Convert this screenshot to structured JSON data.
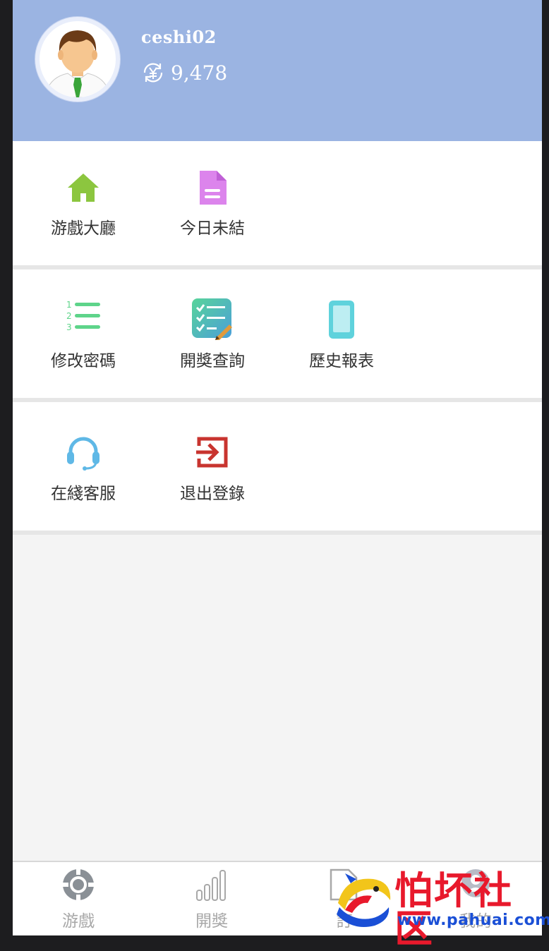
{
  "profile": {
    "username": "ceshi02",
    "balance": "9,478",
    "balance_icon": "yen-exchange-icon",
    "avatar_icon": "male-user-avatar"
  },
  "menu": {
    "row1": [
      {
        "label": "游戲大廳",
        "icon": "home-icon",
        "color": "#8cc63f"
      },
      {
        "label": "今日未結",
        "icon": "document-icon",
        "color": "#d97de8"
      }
    ],
    "row2": [
      {
        "label": "修改密碼",
        "icon": "numbered-list-icon",
        "color": "#5ed48a"
      },
      {
        "label": "開獎查詢",
        "icon": "checklist-icon",
        "color": "#4fb6d6"
      },
      {
        "label": "歷史報表",
        "icon": "tablet-icon",
        "color": "#5fd2dc"
      }
    ],
    "row3": [
      {
        "label": "在綫客服",
        "icon": "headset-icon",
        "color": "#5fb8e6"
      },
      {
        "label": "退出登錄",
        "icon": "logout-icon",
        "color": "#c8342f"
      }
    ]
  },
  "tabbar": {
    "tabs": [
      {
        "label": "游戲",
        "icon": "game-icon"
      },
      {
        "label": "開獎",
        "icon": "bar-chart-icon"
      },
      {
        "label": "訂",
        "icon": "document-icon"
      },
      {
        "label": "我的",
        "icon": "user-icon"
      }
    ]
  },
  "watermark": {
    "title": "怕坏社区",
    "url": "www.pahuai.com"
  },
  "colors": {
    "header_bg": "#9bb4e2",
    "page_bg": "#f4f4f4"
  }
}
